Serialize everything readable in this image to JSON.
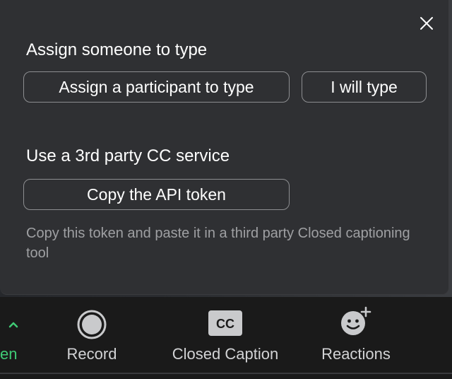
{
  "panel": {
    "close_icon": "close-icon",
    "assign_heading": "Assign someone to type",
    "assign_participant_label": "Assign a participant to type",
    "i_will_type_label": "I will type",
    "third_party_heading": "Use a 3rd party CC service",
    "copy_token_label": "Copy the API token",
    "helper_text": "Copy this token and paste it in a third party Closed captioning tool"
  },
  "toolbar": {
    "share_label_fragment": "en",
    "share_caret_icon": "chevron-up-icon",
    "record_label": "Record",
    "record_icon": "record-icon",
    "closed_caption_label": "Closed Caption",
    "cc_badge_text": "CC",
    "reactions_label": "Reactions",
    "reactions_icon": "smiley-plus-icon"
  },
  "colors": {
    "panel_bg": "#2f3033",
    "button_border": "#8d8e91",
    "helper_text": "#9fa0a3",
    "share_green": "#3fcb75",
    "toolbar_bg": "#1a1a1a"
  }
}
